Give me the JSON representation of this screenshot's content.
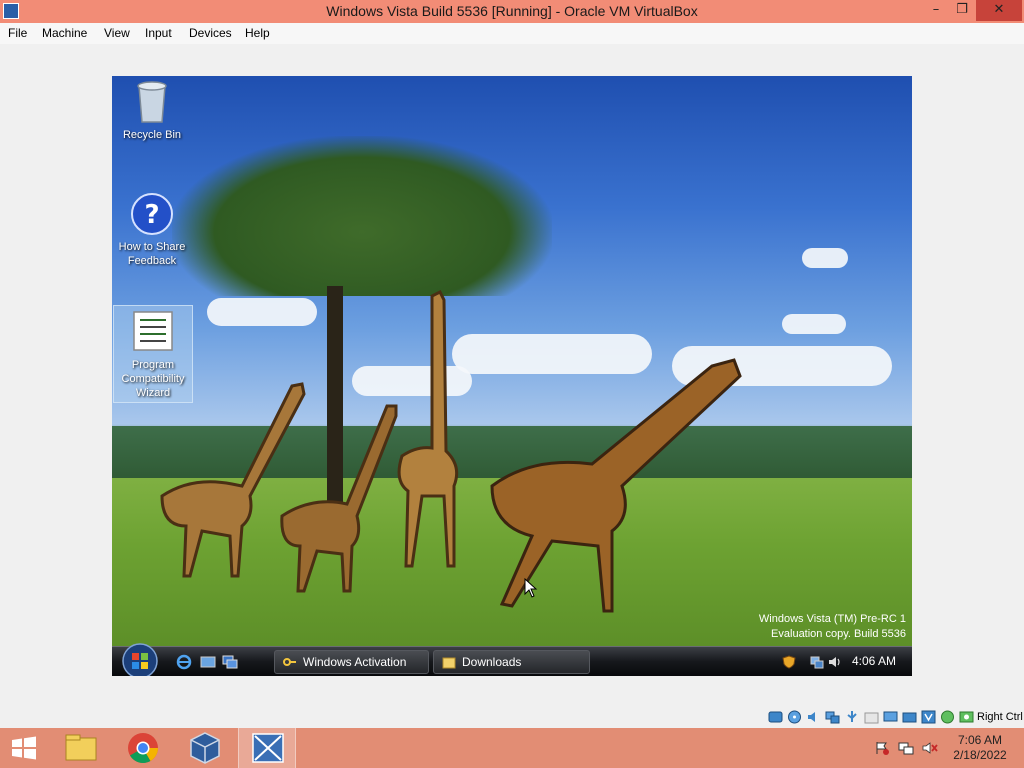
{
  "window": {
    "title": "Windows Vista Build 5536 [Running] - Oracle VM VirtualBox",
    "minimize_glyph": "–",
    "maximize_glyph": "❐",
    "close_glyph": "✕"
  },
  "menu": {
    "file": "File",
    "machine": "Machine",
    "view": "View",
    "input": "Input",
    "devices": "Devices",
    "help": "Help"
  },
  "guest": {
    "desktop_icons": {
      "recycle_bin": "Recycle Bin",
      "feedback_line1": "How to Share",
      "feedback_line2": "Feedback",
      "prog_line1": "Program",
      "prog_line2": "Compatibility",
      "prog_line3": "Wizard"
    },
    "watermark": {
      "line1": "Windows Vista (TM) Pre-RC 1",
      "line2": "Evaluation copy. Build 5536"
    },
    "taskbar": {
      "task1": "Windows Activation",
      "task2": "Downloads",
      "clock": "4:06 AM"
    }
  },
  "status_bar": {
    "host_key": "Right Ctrl"
  },
  "host_taskbar": {
    "time": "7:06 AM",
    "date": "2/18/2022"
  },
  "colors": {
    "titlebar": "#f28c76",
    "host_taskbar": "#e28d74",
    "close_button": "#c7433a"
  }
}
